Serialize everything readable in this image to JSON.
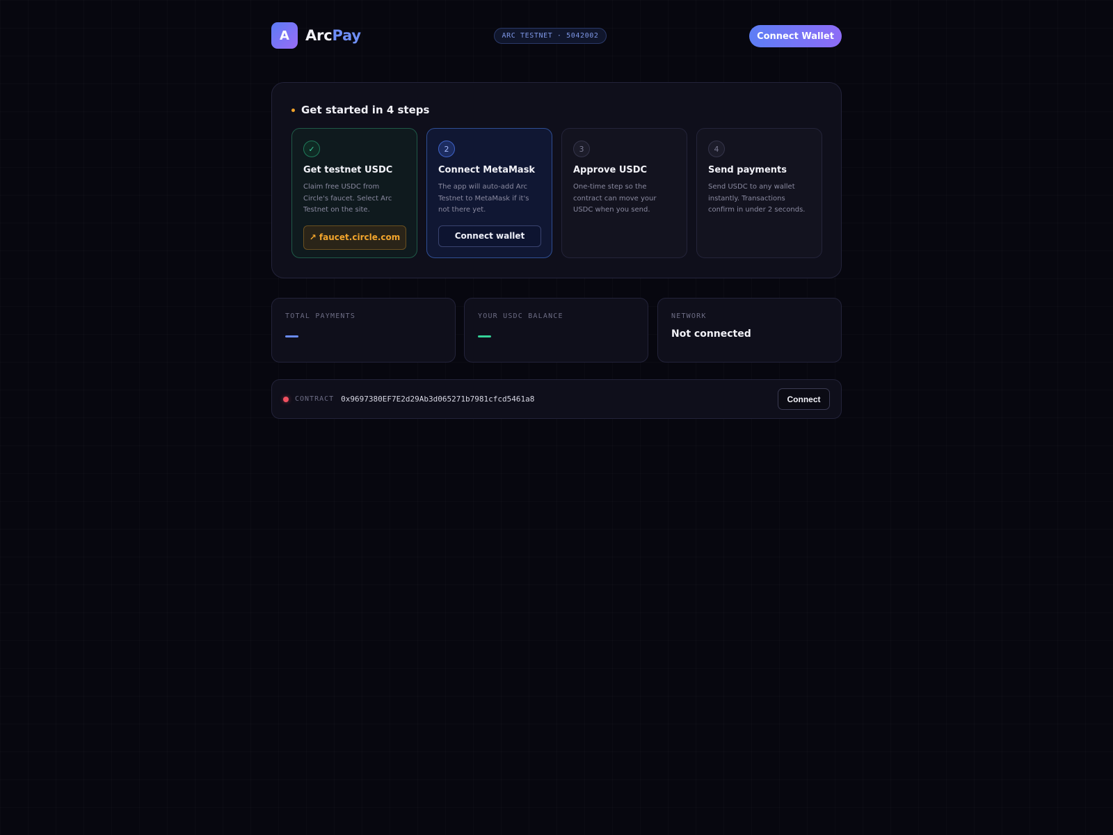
{
  "header": {
    "logo_letter": "A",
    "brand_arc": "Arc",
    "brand_pay": "Pay",
    "network_pill": "ARC TESTNET · 5042002",
    "connect_wallet_label": "Connect Wallet"
  },
  "steps": {
    "title": "Get started in 4 steps",
    "items": [
      {
        "badge": "✓",
        "status": "done",
        "title": "Get testnet USDC",
        "description": "Claim free USDC from Circle's faucet. Select Arc Testnet on the site.",
        "action_label": "↗ faucet.circle.com"
      },
      {
        "badge": "2",
        "status": "active",
        "title": "Connect MetaMask",
        "description": "The app will auto-add Arc Testnet to MetaMask if it's not there yet.",
        "action_label": "Connect wallet"
      },
      {
        "badge": "3",
        "status": "pending",
        "title": "Approve USDC",
        "description": "One-time step so the contract can move your USDC when you send."
      },
      {
        "badge": "4",
        "status": "pending",
        "title": "Send payments",
        "description": "Send USDC to any wallet instantly. Transactions confirm in under 2 seconds."
      }
    ]
  },
  "stats": {
    "total_payments": {
      "label": "TOTAL PAYMENTS",
      "color": "#6a8cf6"
    },
    "usdc_balance": {
      "label": "YOUR USDC BALANCE",
      "color": "#34d399"
    },
    "network": {
      "label": "NETWORK",
      "value": "Not connected"
    }
  },
  "contract": {
    "label": "CONTRACT",
    "address": "0x9697380EF7E2d29Ab3d065271b7981cfcd5461a8",
    "connect_label": "Connect",
    "status_color": "#f05060"
  }
}
